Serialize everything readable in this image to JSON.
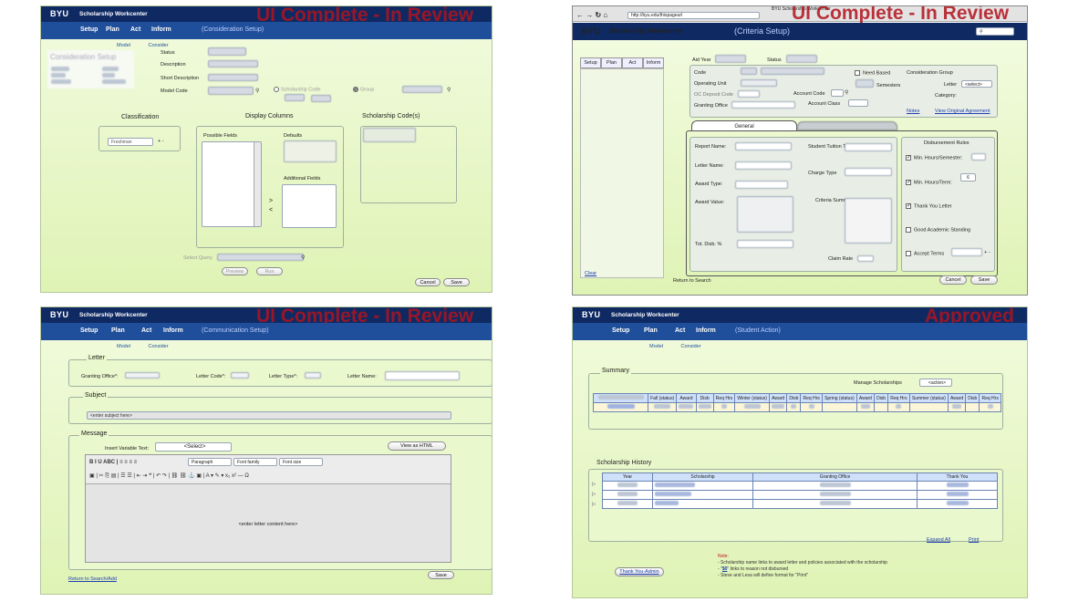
{
  "brand": {
    "logo": "BYU",
    "app_name": "Scholarship Workcenter"
  },
  "nav": [
    "Setup",
    "Plan",
    "Act",
    "Inform"
  ],
  "sub_nav": [
    "Model",
    "Consider"
  ],
  "stamps": {
    "review": "UI Complete - In Review",
    "approved": "Approved"
  },
  "p1": {
    "screen": "(Consideration Setup)",
    "title": "Consideration Setup",
    "status_label": "Status",
    "description_label": "Description",
    "short_description_label": "Short Description",
    "model_code_label": "Model Code",
    "scholarship_code_radio": "Scholarship Code",
    "group_radio": "Group",
    "classification": "Classification",
    "classification_value": "Freshman",
    "classification_ops": "+ -",
    "display_columns": "Display Columns",
    "possible_fields": "Possible Fields",
    "defaults": "Defaults",
    "additional_fields": "Additional Fields",
    "move_right": ">",
    "move_left": "<",
    "scholarship_codes": "Scholarship Code(s)",
    "select_query": "Select Query",
    "preview": "Preview",
    "run": "Run",
    "cancel": "Cancel",
    "save": "Save"
  },
  "p2": {
    "window_title": "BYU Scholarship Workcenter",
    "url": "http://byu.edu/thispageurl",
    "screen": "(Criteria Setup)",
    "left_tabs": [
      "Setup",
      "Plan",
      "Act",
      "Inform"
    ],
    "aid_year": "Aid Year",
    "status": "Status",
    "code": "Code",
    "need_based": "Need Based",
    "consideration_group": "Consideration Group",
    "operating_unit": "Operating Unit",
    "semesters": "Semesters",
    "letter": "Letter",
    "letter_value": "<select>",
    "oc_deposit_code": "OC Deposit Code",
    "account_code": "Account Code",
    "category": "Category:",
    "granting_office": "Granting Office",
    "account_class": "Account Class",
    "notes": "Notes",
    "view_agreement": "View Original Agreement",
    "tab_general": "General",
    "report_name": "Report Name:",
    "student_tuition_type": "Student Tuition Type",
    "letter_name": "Letter Name:",
    "charge_type": "Charge Type",
    "award_type": "Award Type:",
    "award_value": "Award Value:",
    "criteria_summary": "Criteria Summary",
    "tot_disb": "Tot. Disb. %",
    "claim_rate": "Claim Rate",
    "disbursement_rules": "Disbursement Rules",
    "min_hours_semester": "Min. Hours/Semester:",
    "min_hours_term": "Min. Hours/Term:",
    "min_hours_term_value": "6",
    "thank_you_letter": "Thank You Letter",
    "good_academic": "Good Academic Standing",
    "accept_terms": "Accept Terms",
    "accept_terms_ops": "+ -",
    "clear": "Clear",
    "return": "Return to Search",
    "cancel": "Cancel",
    "save": "Save"
  },
  "p3": {
    "screen": "(Communication Setup)",
    "letter": "Letter",
    "granting_office": "Granting Office*:",
    "letter_code": "Letter Code*:",
    "letter_type": "Letter Type*:",
    "letter_name": "Letter Name:",
    "subject": "Subject",
    "subject_placeholder": "<enter subject here>",
    "message": "Message",
    "insert_variable": "Insert Variable Text:",
    "select": "<Select>",
    "view_html": "View as HTML",
    "toolbar_row1": "B  I  U  ABC  |  ≡  ≡  ≡  ≡",
    "paragraph": "Paragraph",
    "font_family": "Font family",
    "font_size": "Font size",
    "toolbar_row2": "▣ | ✂ ⎘ ▤ | ☰ ☰ | ⇤ ⇥ ❝ | ↶ ↷ | ⛓ ⛓ ⚓ ▣ | A ▾ ✎ ▾ x₂ x² — Ω",
    "content_placeholder": "<enter letter content here>",
    "return": "Return to Search/Add",
    "save": "Save"
  },
  "p4": {
    "screen": "(Student Action)",
    "summary": "Summary",
    "manage_scholarships": "Manage Scholarships",
    "action_select": "<action>",
    "summary_headers": [
      "Fall (status)",
      "Award",
      "Disb",
      "Req Hrs",
      "Winter (status)",
      "Award",
      "Disb",
      "Req Hrs",
      "Spring (status)",
      "Award",
      "Disb",
      "Req Hrs",
      "Summer (status)",
      "Award",
      "Disb",
      "Req Hrs"
    ],
    "history": "Scholarship History",
    "history_headers": [
      "Year",
      "Scholarship",
      "Granting Office",
      "Thank You"
    ],
    "expand_all": "Expand All",
    "print": "Print",
    "note_title": "Note:",
    "note_1": "- Scholarship name links to award letter and policies associated with the scholarship",
    "note_2_pre": "- \"",
    "note_2_link": "$0",
    "note_2_post": "\" links to reason not disbursed",
    "note_3": "- Steve and Lesa will define format for \"Print\"",
    "thank_you_admin": "Thank You-Admin"
  }
}
